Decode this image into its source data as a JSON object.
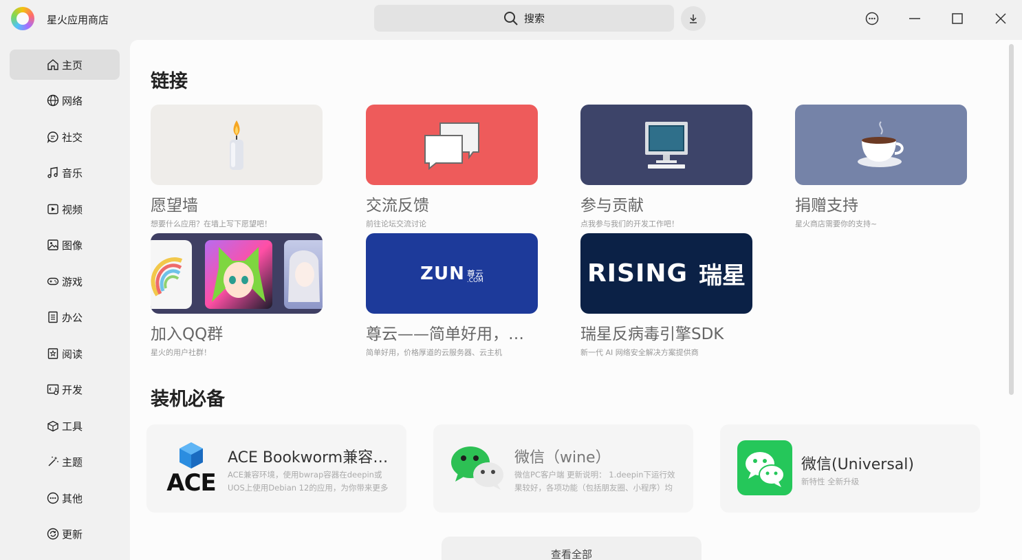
{
  "app": {
    "title": "星火应用商店"
  },
  "search": {
    "label": "搜索"
  },
  "sidebar": {
    "items": [
      {
        "label": "主页",
        "icon": "home-icon"
      },
      {
        "label": "网络",
        "icon": "globe-icon"
      },
      {
        "label": "社交",
        "icon": "chat-icon"
      },
      {
        "label": "音乐",
        "icon": "music-icon"
      },
      {
        "label": "视频",
        "icon": "video-icon"
      },
      {
        "label": "图像",
        "icon": "image-icon"
      },
      {
        "label": "游戏",
        "icon": "gamepad-icon"
      },
      {
        "label": "办公",
        "icon": "document-icon"
      },
      {
        "label": "阅读",
        "icon": "book-icon"
      },
      {
        "label": "开发",
        "icon": "code-icon"
      },
      {
        "label": "工具",
        "icon": "toolbox-icon"
      },
      {
        "label": "主题",
        "icon": "magic-wand-icon"
      },
      {
        "label": "其他",
        "icon": "more-icon"
      },
      {
        "label": "更新",
        "icon": "update-icon"
      }
    ],
    "active_index": 0
  },
  "links": {
    "title": "链接",
    "cards": [
      {
        "title": "愿望墙",
        "desc": "想要什么应用？在墙上写下愿望吧！"
      },
      {
        "title": "交流反馈",
        "desc": "前往论坛交流讨论"
      },
      {
        "title": "参与贡献",
        "desc": "点我参与我们的开发工作吧！"
      },
      {
        "title": "捐赠支持",
        "desc": "星火商店需要你的支持~"
      },
      {
        "title": "加入QQ群",
        "desc": "星火的用户社群！"
      },
      {
        "title": "尊云——简单好用，价格厚道的云服务器",
        "desc": "简单好用，价格厚道的云服务器、云主机"
      },
      {
        "title": "瑞星反病毒引擎SDK",
        "desc": "新一代 AI 网络安全解决方案提供商"
      }
    ],
    "banners": {
      "zun_main": "ZUN",
      "zun_cn": "尊云",
      "zun_com": ".COM",
      "rising_en": "RISING",
      "rising_cn": "瑞星"
    }
  },
  "essentials": {
    "title": "装机必备",
    "apps": [
      {
        "name": "ACE Bookworm兼容环境",
        "desc": "ACE兼容环境，使用bwrap容器在deepin或UOS上使用Debian 12的应用，为你带来更多选择",
        "icon_text": "ACE"
      },
      {
        "name": "微信（wine）",
        "desc": "微信PC客户端 更新说明： 1.deepin下运行效果较好，各项功能（包括朋友圈、小程序）均可用"
      },
      {
        "name": "微信(Universal)",
        "desc": "新特性 全新升级"
      }
    ],
    "view_all": "查看全部"
  },
  "colors": {
    "wish_bg": "#efedea",
    "feedback_bg": "#ee5b5b",
    "contribute_bg": "#3d4469",
    "donate_bg": "#7583a8",
    "zun_bg": "#1d3a9a",
    "rising_bg": "#0b2146",
    "wechat_green": "#25c75a"
  }
}
